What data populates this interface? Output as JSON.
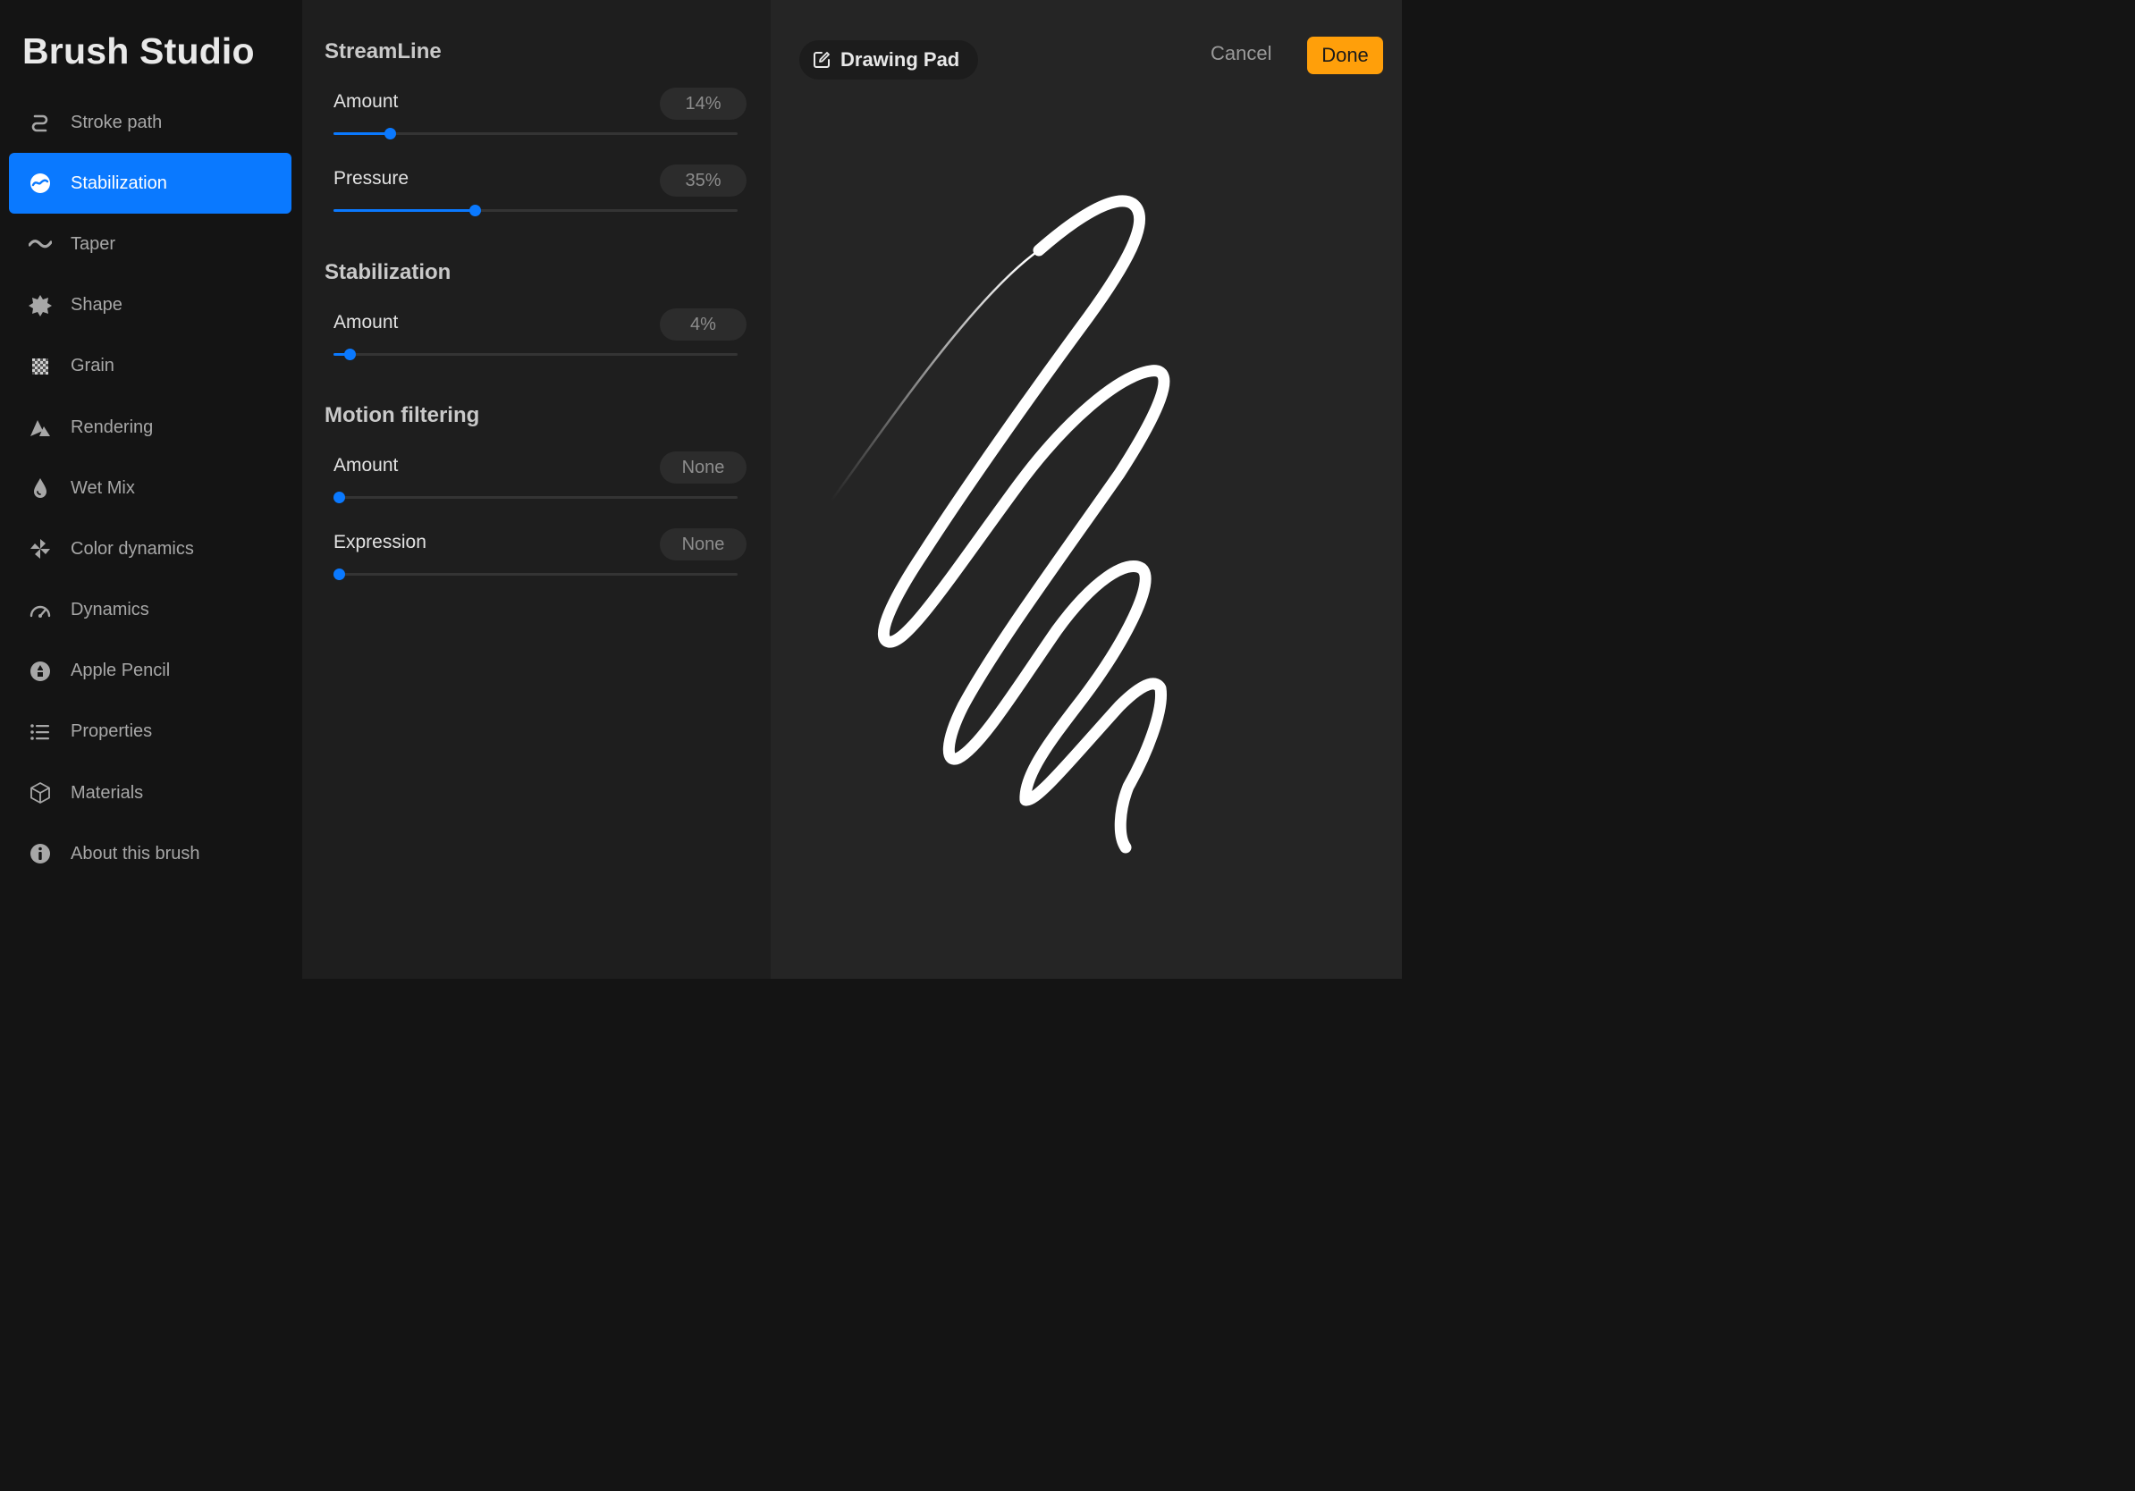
{
  "app": {
    "title": "Brush Studio"
  },
  "sidebar": {
    "items": [
      {
        "label": "Stroke path",
        "icon": "stroke-path-icon",
        "active": false
      },
      {
        "label": "Stabilization",
        "icon": "stabilization-icon",
        "active": true
      },
      {
        "label": "Taper",
        "icon": "taper-icon",
        "active": false
      },
      {
        "label": "Shape",
        "icon": "shape-icon",
        "active": false
      },
      {
        "label": "Grain",
        "icon": "grain-icon",
        "active": false
      },
      {
        "label": "Rendering",
        "icon": "rendering-icon",
        "active": false
      },
      {
        "label": "Wet Mix",
        "icon": "wet-mix-icon",
        "active": false
      },
      {
        "label": "Color dynamics",
        "icon": "color-dynamics-icon",
        "active": false
      },
      {
        "label": "Dynamics",
        "icon": "dynamics-icon",
        "active": false
      },
      {
        "label": "Apple Pencil",
        "icon": "apple-pencil-icon",
        "active": false
      },
      {
        "label": "Properties",
        "icon": "properties-icon",
        "active": false
      },
      {
        "label": "Materials",
        "icon": "materials-icon",
        "active": false
      },
      {
        "label": "About this brush",
        "icon": "info-icon",
        "active": false
      }
    ]
  },
  "settings": {
    "streamline": {
      "title": "StreamLine",
      "amount": {
        "label": "Amount",
        "value": "14%",
        "fraction": 0.14
      },
      "pressure": {
        "label": "Pressure",
        "value": "35%",
        "fraction": 0.35
      }
    },
    "stabilization": {
      "title": "Stabilization",
      "amount": {
        "label": "Amount",
        "value": "4%",
        "fraction": 0.04
      }
    },
    "motion_filtering": {
      "title": "Motion filtering",
      "amount": {
        "label": "Amount",
        "value": "None",
        "fraction": 0.0
      },
      "expression": {
        "label": "Expression",
        "value": "None",
        "fraction": 0.0
      }
    }
  },
  "pad": {
    "badge_label": "Drawing Pad",
    "badge_icon": "edit-icon",
    "cancel_label": "Cancel",
    "done_label": "Done"
  },
  "colors": {
    "accent": "#0a79ff",
    "done": "#ff9f0a",
    "sidebar_bg": "#141414",
    "panel_bg": "#1e1e1e",
    "pad_bg": "#252525"
  }
}
